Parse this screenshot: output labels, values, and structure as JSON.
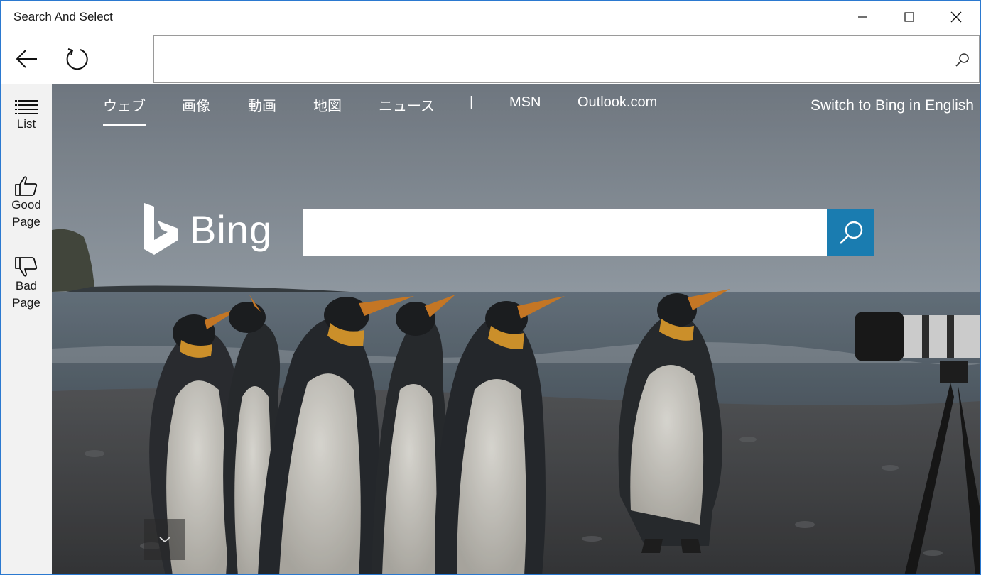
{
  "window": {
    "title": "Search And Select",
    "accent_color": "#2b79d0"
  },
  "controls": {
    "minimize_icon": "minimize-icon",
    "maximize_icon": "maximize-icon",
    "close_icon": "close-icon"
  },
  "toolbar": {
    "back_icon": "arrow-left-icon",
    "refresh_icon": "refresh-icon",
    "address_value": "",
    "address_placeholder": "",
    "search_icon": "search-icon"
  },
  "sidebar": {
    "items": [
      {
        "label": "List",
        "icon": "list-icon"
      },
      {
        "label": "Good\nPage",
        "icon": "thumbs-up-icon"
      },
      {
        "label": "Bad\nPage",
        "icon": "thumbs-down-icon"
      }
    ]
  },
  "bing": {
    "nav": [
      "ウェブ",
      "画像",
      "動画",
      "地図",
      "ニュース",
      "|",
      "MSN",
      "Outlook.com"
    ],
    "active_nav": "ウェブ",
    "switch_language": "Switch to Bing in English",
    "logo_text": "Bing",
    "search_value": "",
    "search_button_color": "#1a7cb0",
    "scroll_down_icon": "chevron-down-icon",
    "background": "penguins-on-beach-photo"
  }
}
